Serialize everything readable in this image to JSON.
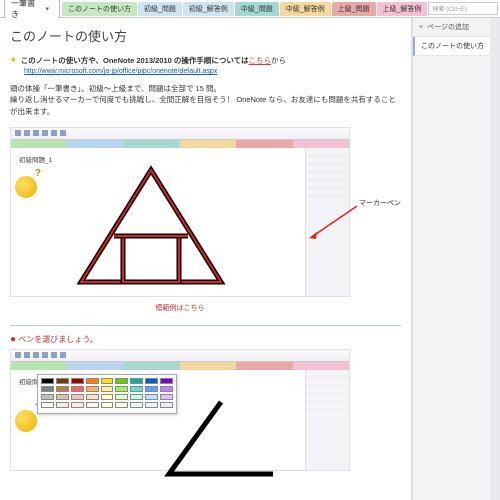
{
  "notebook": {
    "name": "一筆書き"
  },
  "tabs": [
    {
      "label": "このノートの使い方"
    },
    {
      "label": "初級_問題"
    },
    {
      "label": "初級_解答例"
    },
    {
      "label": "中級_問題"
    },
    {
      "label": "中級_解答例"
    },
    {
      "label": "上級_問題"
    },
    {
      "label": "上級_解答例"
    }
  ],
  "search": {
    "placeholder": "検索 (Ctrl+E)"
  },
  "side": {
    "add": "ページの追加",
    "page": "このノートの使い方"
  },
  "page": {
    "title": "このノートの使い方",
    "intro_bold": "このノートの使い方や、OneNote 2013/2010 の操作手順については",
    "intro_link_word": "こちら",
    "intro_tail": "から",
    "ms_link": "http://www.microsoft.com/ja-jp/office/pipc/onenote/default.aspx",
    "body1": "頭の体操「一筆書き」。初級～上級まで、問題は全部で 15 問。",
    "body2": "繰り返し消せるマーカーで何度でも挑戦し、全問正解を目指そう！ OneNote なら、お友達にも問題を共有することが出来ます。",
    "shot_label": "初級問題_1",
    "annot": "マーカーペン",
    "caption": "模範例はこちら",
    "step2": "ペンを選びましょう。"
  },
  "palette_colors": [
    [
      "#000000",
      "#7a3b00",
      "#a00000",
      "#ff8000",
      "#ffe000",
      "#60d000",
      "#00b0a0",
      "#0060d0",
      "#8000d0"
    ],
    [
      "#808080",
      "#c08040",
      "#ff6060",
      "#ffb060",
      "#fff080",
      "#a0f060",
      "#60e0d0",
      "#60a0ff",
      "#c080ff"
    ],
    [
      "#c0c0c0",
      "#e0c0a0",
      "#ffc0c0",
      "#ffe0c0",
      "#ffffc0",
      "#e0ffc0",
      "#c0fff0",
      "#c0e0ff",
      "#e0c0ff"
    ],
    [
      "#ffffff",
      "#f4ece0",
      "#ffe8e8",
      "#fff4e8",
      "#ffffe8",
      "#f4ffe8",
      "#e8fffa",
      "#e8f4ff",
      "#f4e8ff"
    ]
  ]
}
